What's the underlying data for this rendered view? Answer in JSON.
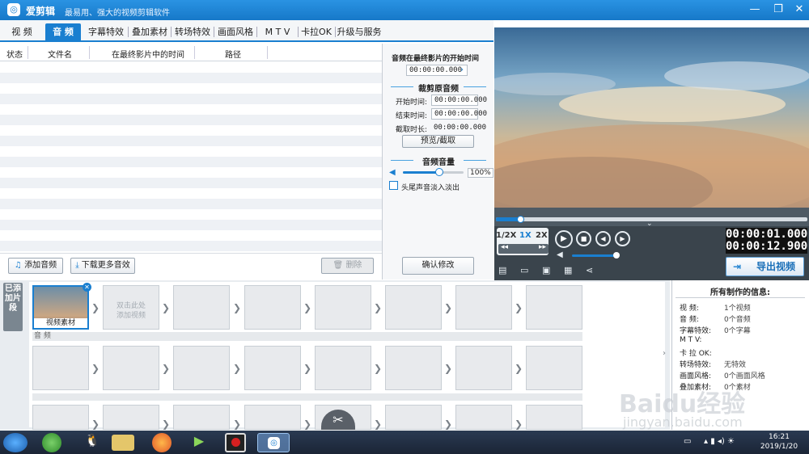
{
  "window": {
    "title": "爱剪辑",
    "slogan": "最易用、强大的视频剪辑软件",
    "minimize": "—",
    "restore": "❐",
    "close": "✕"
  },
  "tabs": [
    {
      "label": "视 频"
    },
    {
      "label": "音 频"
    },
    {
      "label": "字幕特效"
    },
    {
      "label": "叠加素材"
    },
    {
      "label": "转场特效"
    },
    {
      "label": "画面风格"
    },
    {
      "label": "M T V"
    },
    {
      "label": "卡拉OK"
    },
    {
      "label": "升级与服务"
    }
  ],
  "list": {
    "columns": [
      "状态",
      "文件名",
      "在最终影片中的时间",
      "路径"
    ]
  },
  "left_buttons": {
    "add_audio": "添加音频",
    "download_more": "下载更多音效",
    "delete": "删除"
  },
  "audio_panel": {
    "start_in_final_label": "音频在最终影片的开始时间",
    "start_in_final_value": "00:00:00.000",
    "trim_title": "裁剪原音频",
    "start_label": "开始时间:",
    "start_value": "00:00:00.000",
    "end_label": "结束时间:",
    "end_value": "00:00:00.000",
    "duration_label": "截取时长:",
    "duration_value": "00:00:00.000",
    "preview_button": "预览/截取",
    "volume_title": "音频音量",
    "volume_value": "100%",
    "volume_level": 0.6,
    "fade_label": "头尾声音淡入淡出",
    "confirm_button": "确认修改"
  },
  "player": {
    "speed_half": "1/2X",
    "speed_1x": "1X",
    "speed_2x": "2X",
    "time_current": "00:00:01.000",
    "time_total": "00:00:12.900",
    "export_label": "导出视频",
    "accent": "#1a7fd0"
  },
  "timeline": {
    "added_label": "已添加片段",
    "clip_label": "视频素材",
    "hint_line1": "双击此处",
    "hint_line2": "添加视频",
    "audio_track_label": "音 频"
  },
  "info_panel": {
    "title": "所有制作的信息:",
    "rows": [
      {
        "label": "视  频:",
        "value": "1个视频"
      },
      {
        "label": "音  频:",
        "value": "0个音频"
      },
      {
        "label": "字幕特效:",
        "value": "0个字幕"
      },
      {
        "label": "M T V:",
        "value": ""
      },
      {
        "label": "卡 拉 OK:",
        "value": ""
      },
      {
        "label": "转场特效:",
        "value": "无特效"
      },
      {
        "label": "画面风格:",
        "value": "0个画面风格"
      },
      {
        "label": "叠加素材:",
        "value": "0个素材"
      }
    ]
  },
  "taskbar": {
    "clock_time": "16:21",
    "clock_date": "2019/1/20"
  },
  "watermark": {
    "line1": "Baidu经验",
    "line2": "jingyan.baidu.com"
  }
}
